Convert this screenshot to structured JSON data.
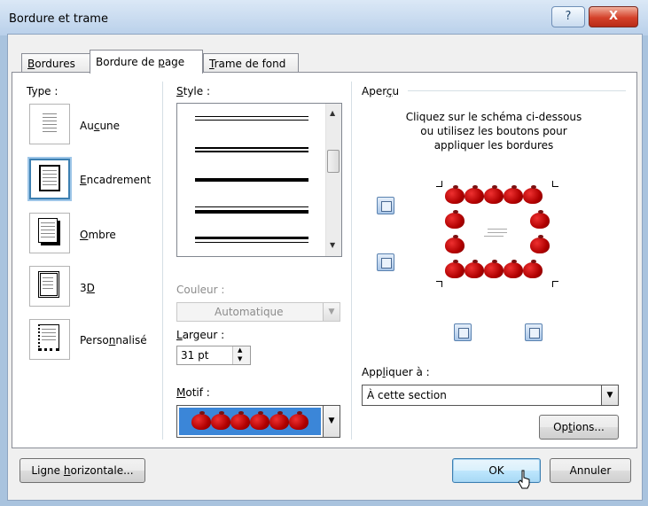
{
  "window": {
    "title": "Bordure et trame",
    "help_symbol": "?",
    "close_symbol": "X"
  },
  "tabs": [
    {
      "label_u": "B",
      "label_rest": "ordures"
    },
    {
      "label_pre": "Bordure de ",
      "label_u": "p",
      "label_rest": "age"
    },
    {
      "label_u": "T",
      "label_rest": "rame de fond"
    }
  ],
  "type_section": {
    "label": "Type :",
    "options": [
      {
        "u": "",
        "pre": "Au",
        "uu": "c",
        "post": "une"
      },
      {
        "pre": "",
        "uu": "E",
        "post": "ncadrement"
      },
      {
        "pre": "",
        "uu": "O",
        "post": "mbre"
      },
      {
        "pre": "3",
        "uu": "D",
        "post": ""
      },
      {
        "pre": "Perso",
        "uu": "n",
        "post": "nalisé"
      }
    ]
  },
  "style_section": {
    "label_u": "S",
    "label_rest": "tyle :"
  },
  "couleur": {
    "label": "Couleur :",
    "value": "Automatique"
  },
  "largeur": {
    "label_u": "L",
    "label_rest": "argeur :",
    "value": "31 pt"
  },
  "motif": {
    "label_u": "M",
    "label_rest": "otif :"
  },
  "apercu": {
    "label_pre": "Aper",
    "label_u": "ç",
    "label_rest": "u",
    "instruction_1": "Cliquez sur le schéma ci-dessous",
    "instruction_2": "ou utilisez les boutons pour",
    "instruction_3": "appliquer les bordures"
  },
  "appliquer": {
    "label_pre": "App",
    "label_u": "l",
    "label_rest": "iquer à :",
    "value": "À cette section"
  },
  "buttons": {
    "options": {
      "pre": "Op",
      "u": "t",
      "post": "ions..."
    },
    "ligne_horizontale": {
      "pre": "Ligne ",
      "u": "h",
      "post": "orizontale..."
    },
    "ok": "OK",
    "annuler": "Annuler"
  }
}
